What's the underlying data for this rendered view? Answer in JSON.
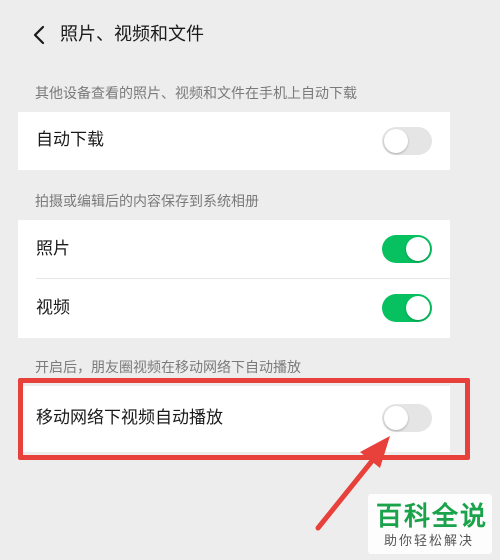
{
  "header": {
    "title": "照片、视频和文件"
  },
  "section_auto_download": {
    "label": "其他设备查看的照片、视频和文件在手机上自动下载",
    "row_label": "自动下载",
    "toggle_on": false
  },
  "section_save": {
    "label": "拍摄或编辑后的内容保存到系统相册",
    "rows": [
      {
        "label": "照片",
        "toggle_on": true
      },
      {
        "label": "视频",
        "toggle_on": true
      }
    ]
  },
  "section_autoplay": {
    "label": "开启后，朋友圈视频在移动网络下自动播放",
    "row_label": "移动网络下视频自动播放",
    "toggle_on": false
  },
  "watermark": {
    "main": "百科全说",
    "sub": "助你轻松解决"
  },
  "colors": {
    "accent_green": "#07c160",
    "highlight_red": "#e8403a",
    "toggle_off": "#e5e5e5",
    "background": "#ededed"
  }
}
